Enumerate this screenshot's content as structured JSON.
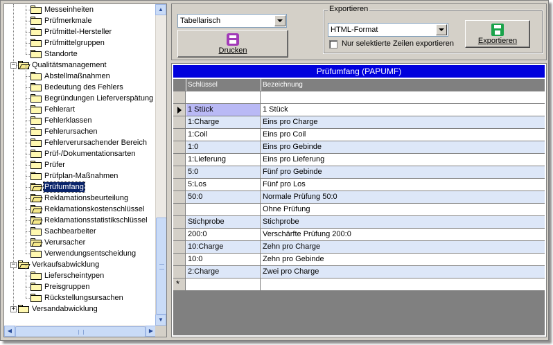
{
  "tree": {
    "items": [
      {
        "label": "Messeinheiten",
        "level": 2,
        "open": false
      },
      {
        "label": "Prüfmerkmale",
        "level": 2,
        "open": false
      },
      {
        "label": "Prüfmittel-Hersteller",
        "level": 2,
        "open": false
      },
      {
        "label": "Prüfmittelgruppen",
        "level": 2,
        "open": false
      },
      {
        "label": "Standorte",
        "level": 2,
        "open": false
      },
      {
        "label": "Qualitätsmanagement",
        "level": 1,
        "open": true
      },
      {
        "label": "Abstellmaßnahmen",
        "level": 2,
        "open": false
      },
      {
        "label": "Bedeutung des Fehlers",
        "level": 2,
        "open": false
      },
      {
        "label": "Begründungen Lieferverspätung",
        "level": 2,
        "open": false
      },
      {
        "label": "Fehlerart",
        "level": 2,
        "open": false
      },
      {
        "label": "Fehlerklassen",
        "level": 2,
        "open": false
      },
      {
        "label": "Fehlerursachen",
        "level": 2,
        "open": false
      },
      {
        "label": "Fehlerverursachender Bereich",
        "level": 2,
        "open": false
      },
      {
        "label": "Prüf-/Dokumentationsarten",
        "level": 2,
        "open": false
      },
      {
        "label": "Prüfer",
        "level": 2,
        "open": false
      },
      {
        "label": "Prüfplan-Maßnahmen",
        "level": 2,
        "open": false
      },
      {
        "label": "Prüfumfang",
        "level": 2,
        "open": true,
        "selected": true
      },
      {
        "label": "Reklamationsbeurteilung",
        "level": 2,
        "open": true
      },
      {
        "label": "Reklamationskostenschlüssel",
        "level": 2,
        "open": true
      },
      {
        "label": "Reklamationsstatistikschlüssel",
        "level": 2,
        "open": true
      },
      {
        "label": "Sachbearbeiter",
        "level": 2,
        "open": false
      },
      {
        "label": "Verursacher",
        "level": 2,
        "open": true
      },
      {
        "label": "Verwendungsentscheidung",
        "level": 2,
        "open": false
      },
      {
        "label": "Verkaufsabwicklung",
        "level": 1,
        "open": true
      },
      {
        "label": "Lieferscheintypen",
        "level": 2,
        "open": false
      },
      {
        "label": "Preisgruppen",
        "level": 2,
        "open": false
      },
      {
        "label": "Rückstellungsursachen",
        "level": 2,
        "open": false
      },
      {
        "label": "Versandabwicklung",
        "level": 1,
        "open": false
      }
    ]
  },
  "toolbar": {
    "view_select": "Tabellarisch",
    "print_label": "Drucken",
    "export_group": "Exportieren",
    "export_format": "HTML-Format",
    "selected_only_label": "Nur selektierte Zeilen exportieren",
    "export_label": "Exportieren"
  },
  "grid": {
    "title": "Prüfumfang (PAPUMF)",
    "columns": [
      "Schlüssel",
      "Bezeichnung"
    ],
    "rows": [
      [
        "1 Stück",
        "1 Stück"
      ],
      [
        "1:Charge",
        "Eins pro Charge"
      ],
      [
        "1:Coil",
        "Eins pro Coil"
      ],
      [
        "1:0",
        "Eins pro Gebinde"
      ],
      [
        "1:Lieferung",
        "Eins pro Lieferung"
      ],
      [
        "5:0",
        "Fünf pro Gebinde"
      ],
      [
        "5:Los",
        "Fünf pro Los"
      ],
      [
        "50:0",
        "Normale Prüfung 50:0"
      ],
      [
        "",
        "Ohne Prüfung"
      ],
      [
        "Stichprobe",
        "Stichprobe"
      ],
      [
        "200:0",
        "Verschärfte Prüfung 200:0"
      ],
      [
        "10:Charge",
        "Zehn pro Charge"
      ],
      [
        "10:0",
        "Zehn pro Gebinde"
      ],
      [
        "2:Charge",
        "Zwei pro Charge"
      ]
    ],
    "current_row": 0,
    "new_row_marker": "*"
  }
}
